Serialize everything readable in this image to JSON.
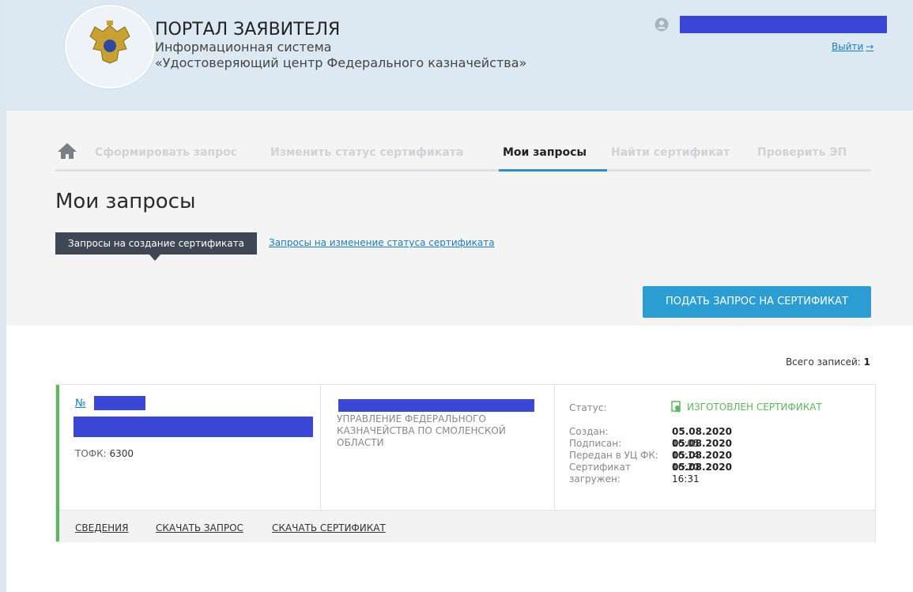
{
  "header": {
    "portal_title": "ПОРТАЛ ЗАЯВИТЕЛЯ",
    "subtitle_line1": "Информационная система",
    "subtitle_line2": "«Удостоверяющий центр Федерального казначейства»",
    "logo_icon": "coat-of-arms-icon",
    "user_icon": "user-icon",
    "logout_label": "Выйти",
    "logout_arrow": "→"
  },
  "nav": {
    "home_icon": "home-icon",
    "items": [
      {
        "label": "Сформировать запрос",
        "active": false
      },
      {
        "label": "Изменить статус сертификата",
        "active": false
      },
      {
        "label": "Мои запросы",
        "active": true
      },
      {
        "label": "Найти сертификат",
        "active": false
      },
      {
        "label": "Проверить ЭП",
        "active": false
      }
    ]
  },
  "page": {
    "heading": "Мои запросы",
    "tab_active": "Запросы на создание сертификата",
    "tab_link": "Запросы на изменение статуса сертификата",
    "submit_button": "ПОДАТЬ ЗАПРОС НА СЕРТИФИКАТ",
    "total_label": "Всего записей:",
    "total_count": "1"
  },
  "request": {
    "number_prefix": "№",
    "tofk_label": "ТОФК:",
    "tofk_value": "6300",
    "org_name": "УПРАВЛЕНИЕ ФЕДЕРАЛЬНОГО КАЗНАЧЕЙСТВА ПО СМОЛЕНСКОЙ ОБЛАСТИ",
    "status_label": "Статус:",
    "status_value": "ИЗГОТОВЛЕН СЕРТИФИКАТ",
    "status_icon": "certificate-icon",
    "dates": [
      {
        "label": "Создан:",
        "date": "05.08.2020",
        "time": "16:05"
      },
      {
        "label": "Подписан:",
        "date": "05.08.2020",
        "time": "16:14"
      },
      {
        "label": "Передан в УЦ ФК:",
        "date": "05.08.2020",
        "time": "16:20"
      },
      {
        "label": "Сертификат загружен:",
        "date": "05.08.2020",
        "time": "16:31"
      }
    ],
    "actions": {
      "details": "СВЕДЕНИЯ",
      "download_request": "СКАЧАТЬ ЗАПРОС",
      "download_certificate": "СКАЧАТЬ СЕРТИФИКАТ"
    }
  },
  "colors": {
    "header_bg": "#dce9f3",
    "accent_blue": "#2b9dd3",
    "link_blue": "#1a7fc1",
    "success_green": "#5cb85c",
    "redaction": "#3a47d6"
  }
}
